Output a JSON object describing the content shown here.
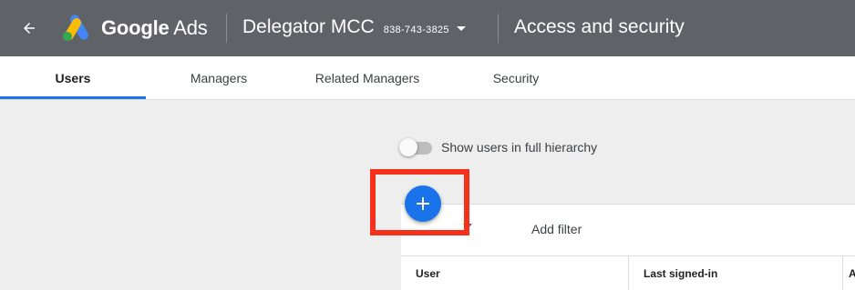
{
  "header": {
    "brand_name": "Google",
    "brand_product": "Ads",
    "account_name": "Delegator MCC",
    "account_id": "838-743-3825",
    "page_title": "Access and security"
  },
  "tabs": [
    {
      "label": "Users",
      "active": true
    },
    {
      "label": "Managers",
      "active": false
    },
    {
      "label": "Related Managers",
      "active": false
    },
    {
      "label": "Security",
      "active": false
    }
  ],
  "toggle": {
    "label": "Show users in full hierarchy",
    "on": false
  },
  "filter": {
    "label": "Add filter"
  },
  "table": {
    "columns": [
      "User",
      "Last signed-in",
      "A"
    ]
  },
  "fab": {
    "icon": "plus-icon"
  },
  "colors": {
    "topbar": "#5f6368",
    "accent": "#1a73e8",
    "highlight": "#f4311d"
  }
}
